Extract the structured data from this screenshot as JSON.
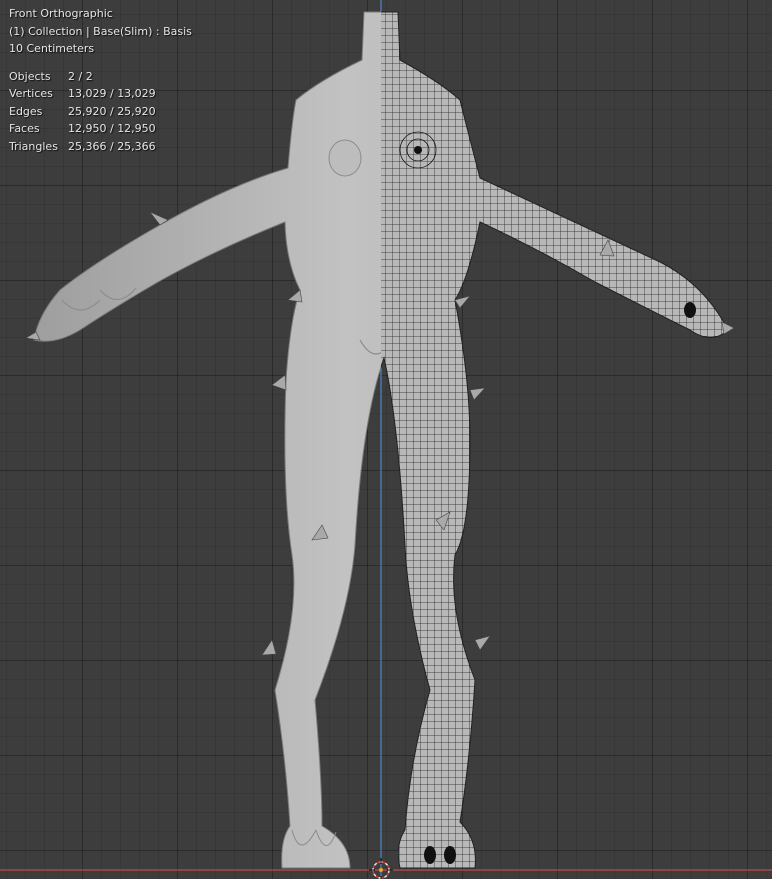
{
  "viewport": {
    "view_name": "Front Orthographic",
    "collection_line": "(1) Collection | Base(Slim) : Basis",
    "scale_text": "10 Centimeters"
  },
  "stats": [
    {
      "label": "Objects",
      "value": "2 / 2"
    },
    {
      "label": "Vertices",
      "value": "13,029 / 13,029"
    },
    {
      "label": "Edges",
      "value": "25,920 / 25,920"
    },
    {
      "label": "Faces",
      "value": "12,950 / 12,950"
    },
    {
      "label": "Triangles",
      "value": "25,366 / 25,366"
    }
  ],
  "colors": {
    "background": "#3d3d3d",
    "mesh_fill": "#b4b4b4",
    "z_axis": "#4e86c4",
    "x_axis": "#c24a4a",
    "wire": "#1a1a1a"
  },
  "icons": {
    "origin_cursor": "3d-cursor-icon"
  }
}
